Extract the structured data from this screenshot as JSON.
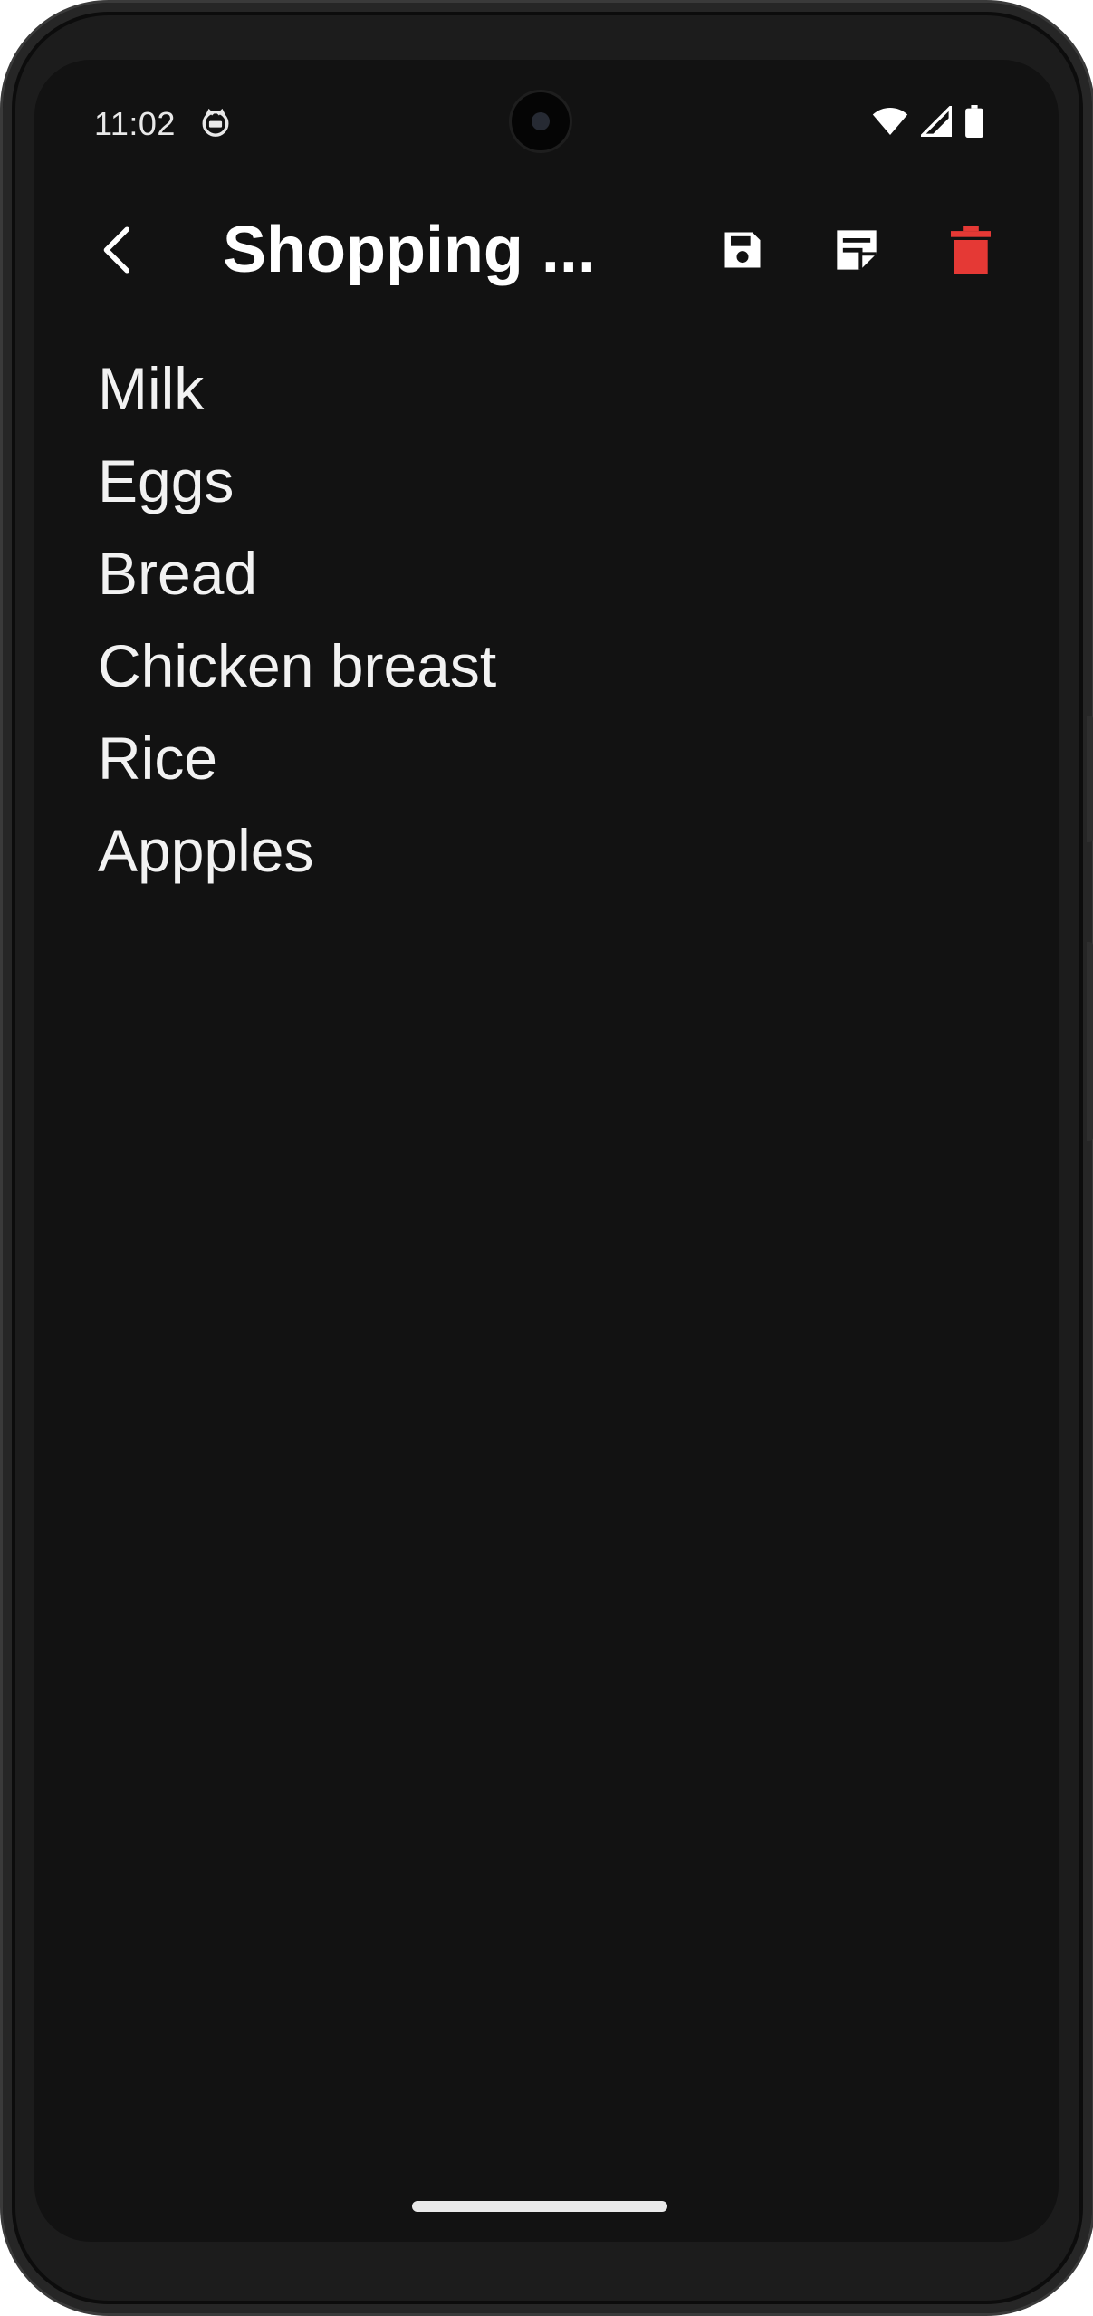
{
  "status_bar": {
    "time": "11:02",
    "notification_icon": "cat-face-icon",
    "icons": [
      "wifi-icon",
      "cellular-signal-icon",
      "battery-icon"
    ]
  },
  "app_bar": {
    "back_icon": "chevron-left-icon",
    "title": "Shopping ...",
    "actions": [
      {
        "name": "save",
        "icon": "floppy-disk-icon"
      },
      {
        "name": "notes",
        "icon": "note-icon"
      },
      {
        "name": "delete",
        "icon": "trash-icon"
      }
    ]
  },
  "note": {
    "lines": [
      "Milk",
      "Eggs",
      "Bread",
      "Chicken breast",
      "Rice",
      "Appples"
    ]
  },
  "colors": {
    "background": "#121212",
    "text": "#ffffff",
    "delete_accent": "#e53935"
  }
}
